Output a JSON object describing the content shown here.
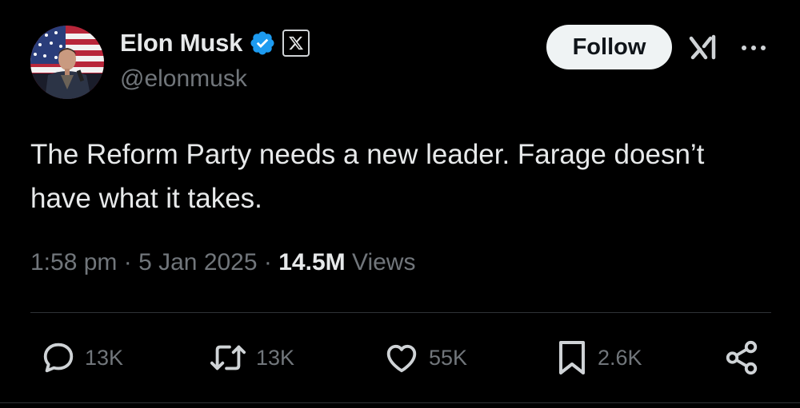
{
  "colors": {
    "background": "#000000",
    "primary_text": "#e7e9ea",
    "secondary_text": "#71767b",
    "verified_badge": "#1d9bf0",
    "follow_button_bg": "#eff3f4",
    "divider": "#2f3336"
  },
  "author": {
    "name": "Elon Musk",
    "handle": "@elonmusk",
    "avatar": "avatar-photo",
    "badges": [
      "verified-badge-icon",
      "x-affiliation-icon"
    ]
  },
  "header": {
    "follow_label": "Follow",
    "grok_icon": "grok-icon",
    "more_icon": "more-dots-icon"
  },
  "tweet": {
    "text": "The Reform Party needs a new leader. Farage doesn’t have what it takes.",
    "time": "1:58 pm",
    "date": "5 Jan 2025",
    "separator": "·",
    "views_count": "14.5M",
    "views_label": "Views"
  },
  "actions": {
    "reply": {
      "icon": "reply-icon",
      "count": "13K"
    },
    "repost": {
      "icon": "repost-icon",
      "count": "13K"
    },
    "like": {
      "icon": "heart-icon",
      "count": "55K"
    },
    "bookmark": {
      "icon": "bookmark-icon",
      "count": "2.6K"
    },
    "share": {
      "icon": "share-icon"
    }
  }
}
